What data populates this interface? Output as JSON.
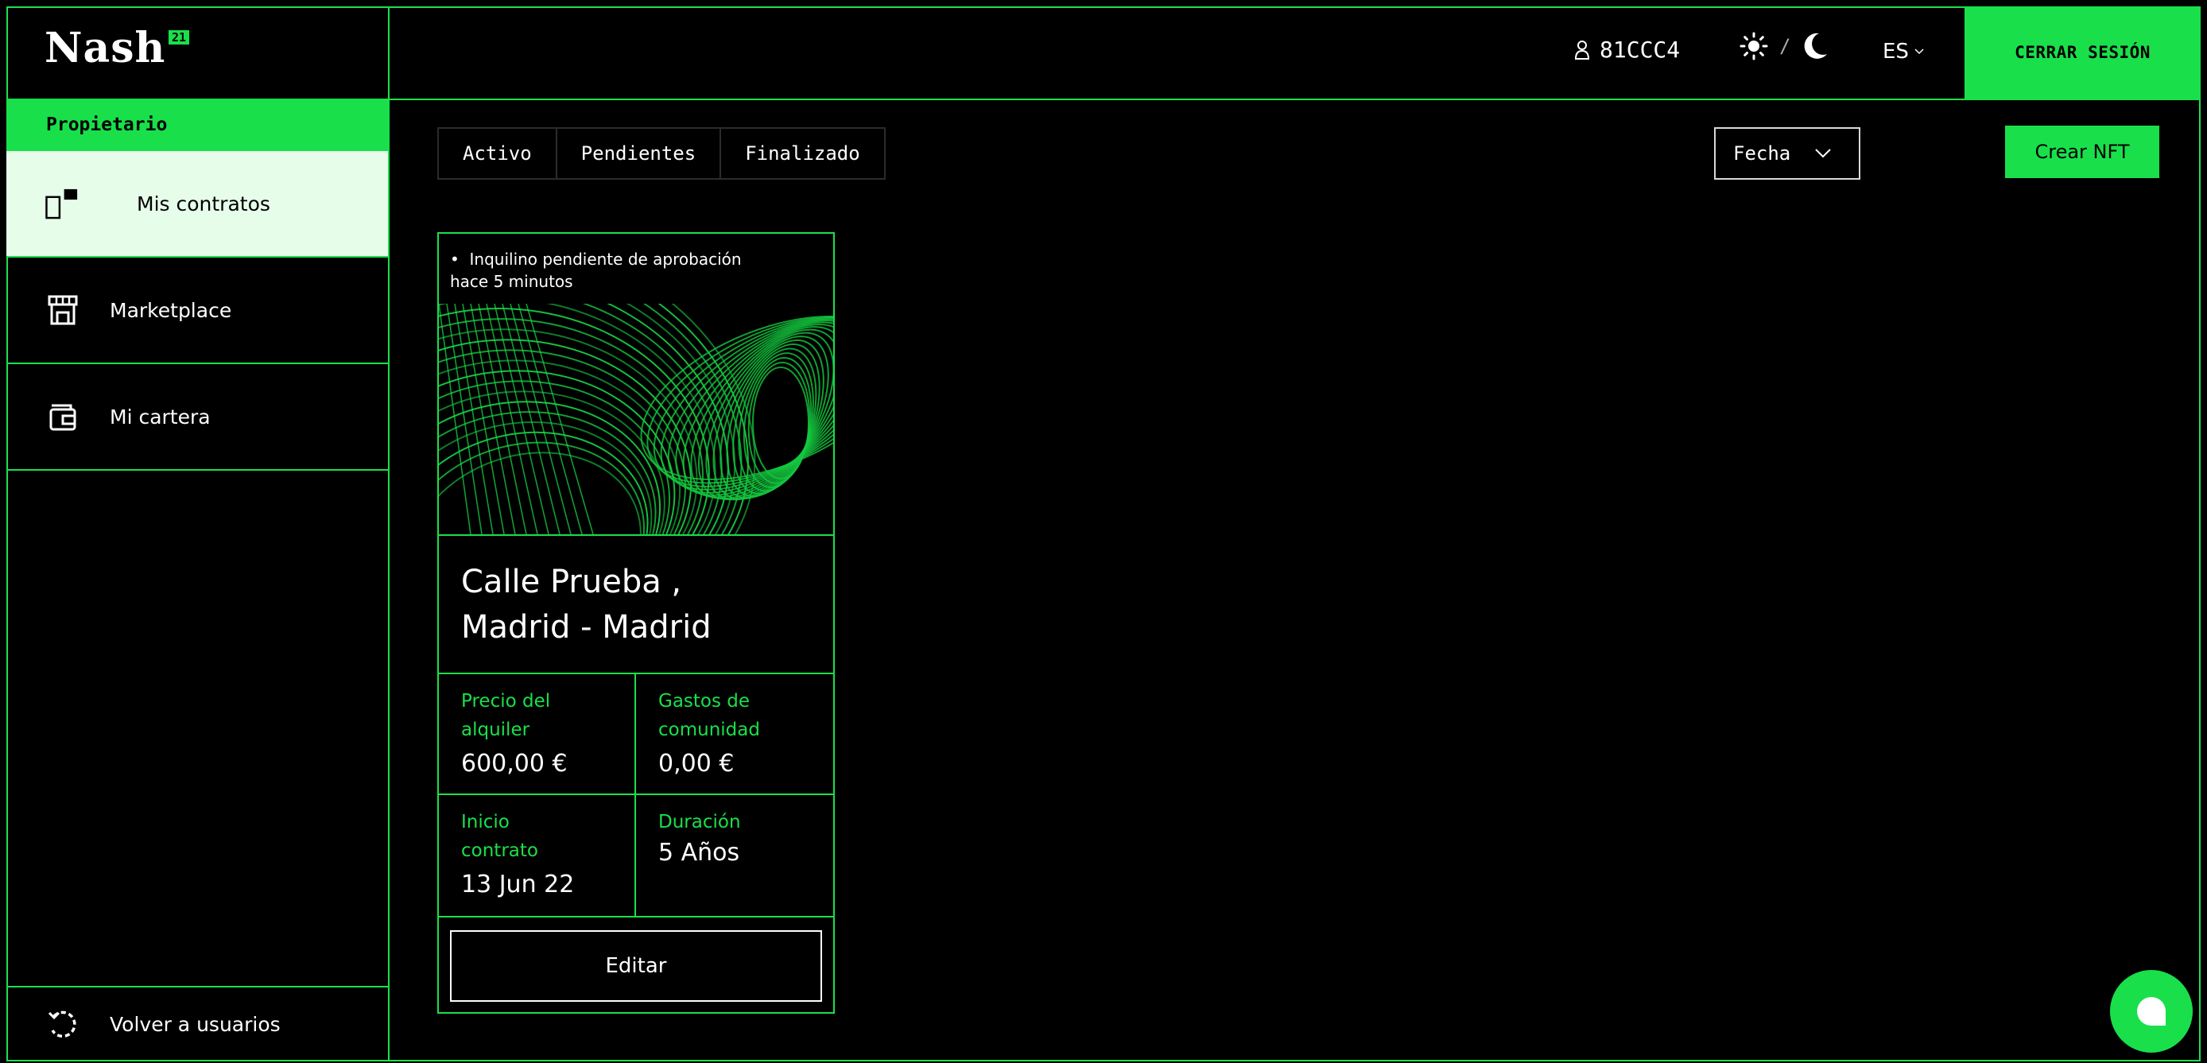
{
  "app": {
    "logo": "Nash",
    "logo_badge": "21"
  },
  "header": {
    "user_id": "81CCC4",
    "theme_separator": "/",
    "language": "ES",
    "logout_label": "CERRAR SESIÓN"
  },
  "sidebar": {
    "role_label": "Propietario",
    "items": [
      {
        "label": "Mis contratos",
        "icon": "contracts-icon",
        "active": true
      },
      {
        "label": "Marketplace",
        "icon": "store-icon",
        "active": false
      },
      {
        "label": "Mi cartera",
        "icon": "wallet-icon",
        "active": false
      }
    ],
    "back_label": "Volver a usuarios"
  },
  "tabs": [
    {
      "label": "Activo"
    },
    {
      "label": "Pendientes"
    },
    {
      "label": "Finalizado"
    }
  ],
  "sort": {
    "label": "Fecha"
  },
  "create_label": "Crear NFT",
  "contract_card": {
    "status": "Inquilino pendiente de aprobación",
    "status_time": "hace 5 minutos",
    "address_line1": "Calle Prueba ,",
    "address_line2": "Madrid - Madrid",
    "rent_label": "Precio del alquiler",
    "rent_value": "600,00 €",
    "fees_label": "Gastos de comunidad",
    "fees_value": "0,00 €",
    "start_label": "Inicio contrato",
    "start_value": "13 Jun 22",
    "duration_label": "Duración",
    "duration_value": "5 Años",
    "edit_label": "Editar"
  },
  "colors": {
    "accent": "#19e04a",
    "background": "#000000",
    "active_item_bg": "#e6fdea"
  }
}
